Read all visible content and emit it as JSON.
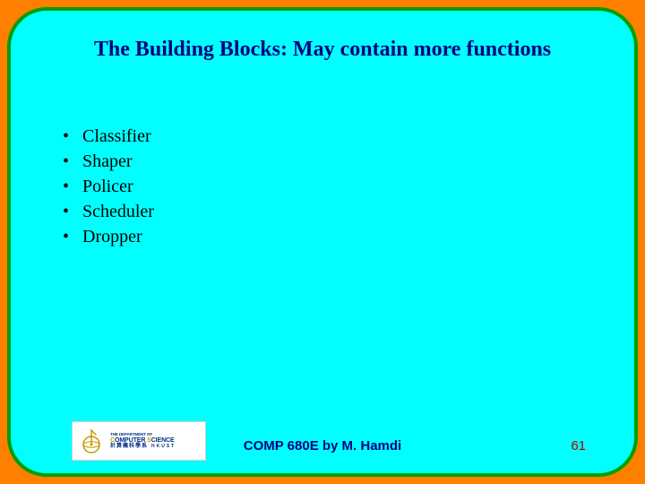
{
  "title": "The Building Blocks: May contain more functions",
  "bullets": [
    "Classifier",
    "Shaper",
    "Policer",
    "Scheduler",
    "Dropper"
  ],
  "footer": {
    "center": "COMP 680E by M. Hamdi",
    "page_number": "61"
  },
  "logo": {
    "line1": "THE DEPARTMENT OF",
    "line2_pre": "C",
    "line2_mid_a": "OMPUTER ",
    "line2_pre2": "S",
    "line2_mid_b": "CIENCE",
    "line3_cjk": "計算機科學系",
    "line3_latin": "HKUST"
  }
}
